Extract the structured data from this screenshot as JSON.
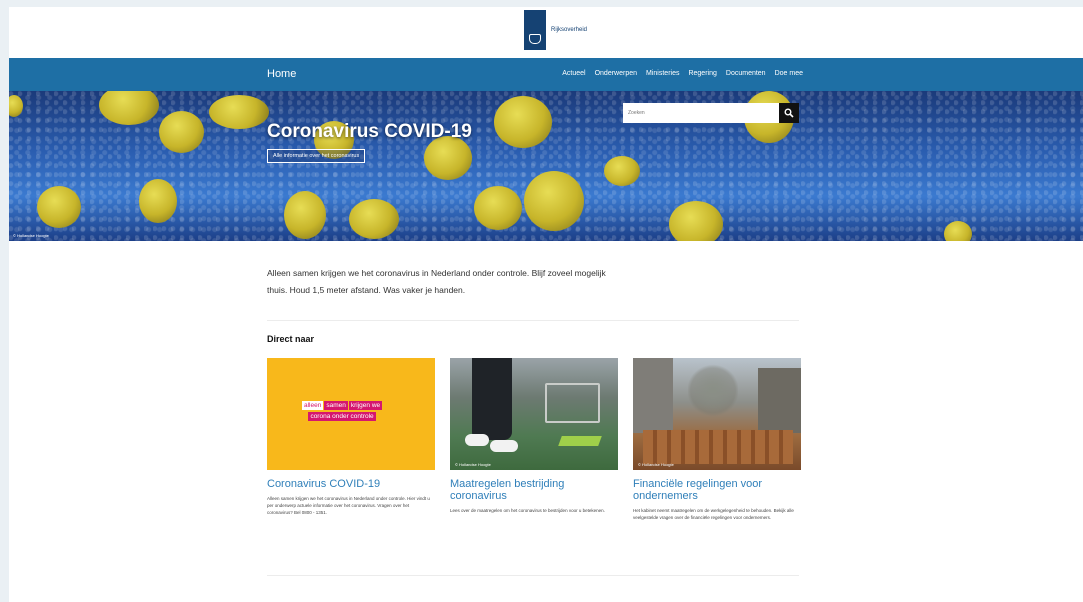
{
  "header": {
    "logo_text": "Rijksoverheid"
  },
  "nav": {
    "home": "Home",
    "items": [
      "Actueel",
      "Onderwerpen",
      "Ministeries",
      "Regering",
      "Documenten",
      "Doe mee"
    ]
  },
  "hero": {
    "title": "Coronavirus COVID-19",
    "link": "Alle informatie over het coronavirus",
    "search_placeholder": "Zoeken",
    "credit": "© Hollandse Hoogte"
  },
  "intro": {
    "text": "Alleen samen krijgen we het coronavirus in Nederland onder controle. Blijf zoveel mogelijk thuis. Houd 1,5 meter afstand. Was vaker je handen."
  },
  "direct": {
    "title": "Direct naar",
    "cards": [
      {
        "badge_line1": [
          "alleen",
          "samen",
          "krijgen we"
        ],
        "badge_line2": "corona onder controle",
        "title": "Coronavirus COVID-19",
        "desc": "Alleen samen krijgen we het coronavirus in Nederland onder controle. Hier vindt u per onderwerp actuele informatie over het coronavirus. Vragen over het coronavirus? Bel 0800 - 1351."
      },
      {
        "credit": "© Hollandse Hoogte",
        "title": "Maatregelen bestrijding coronavirus",
        "desc": "Lees over de maatregelen om het coronavirus te bestrijden voor u betekenen."
      },
      {
        "credit": "© Hollandse Hoogte",
        "title": "Financiële regelingen voor ondernemers",
        "desc": "Het kabinet neemt maatregelen om de werkgelegenheid te behouden. Bekijk alle veelgestelde vragen over de financiële regelingen voor ondernemers."
      }
    ]
  },
  "colors": {
    "nav": "#1e6fa5",
    "link": "#2f7fb9",
    "badge": "#d5166e",
    "card1_bg": "#f8b81b"
  }
}
